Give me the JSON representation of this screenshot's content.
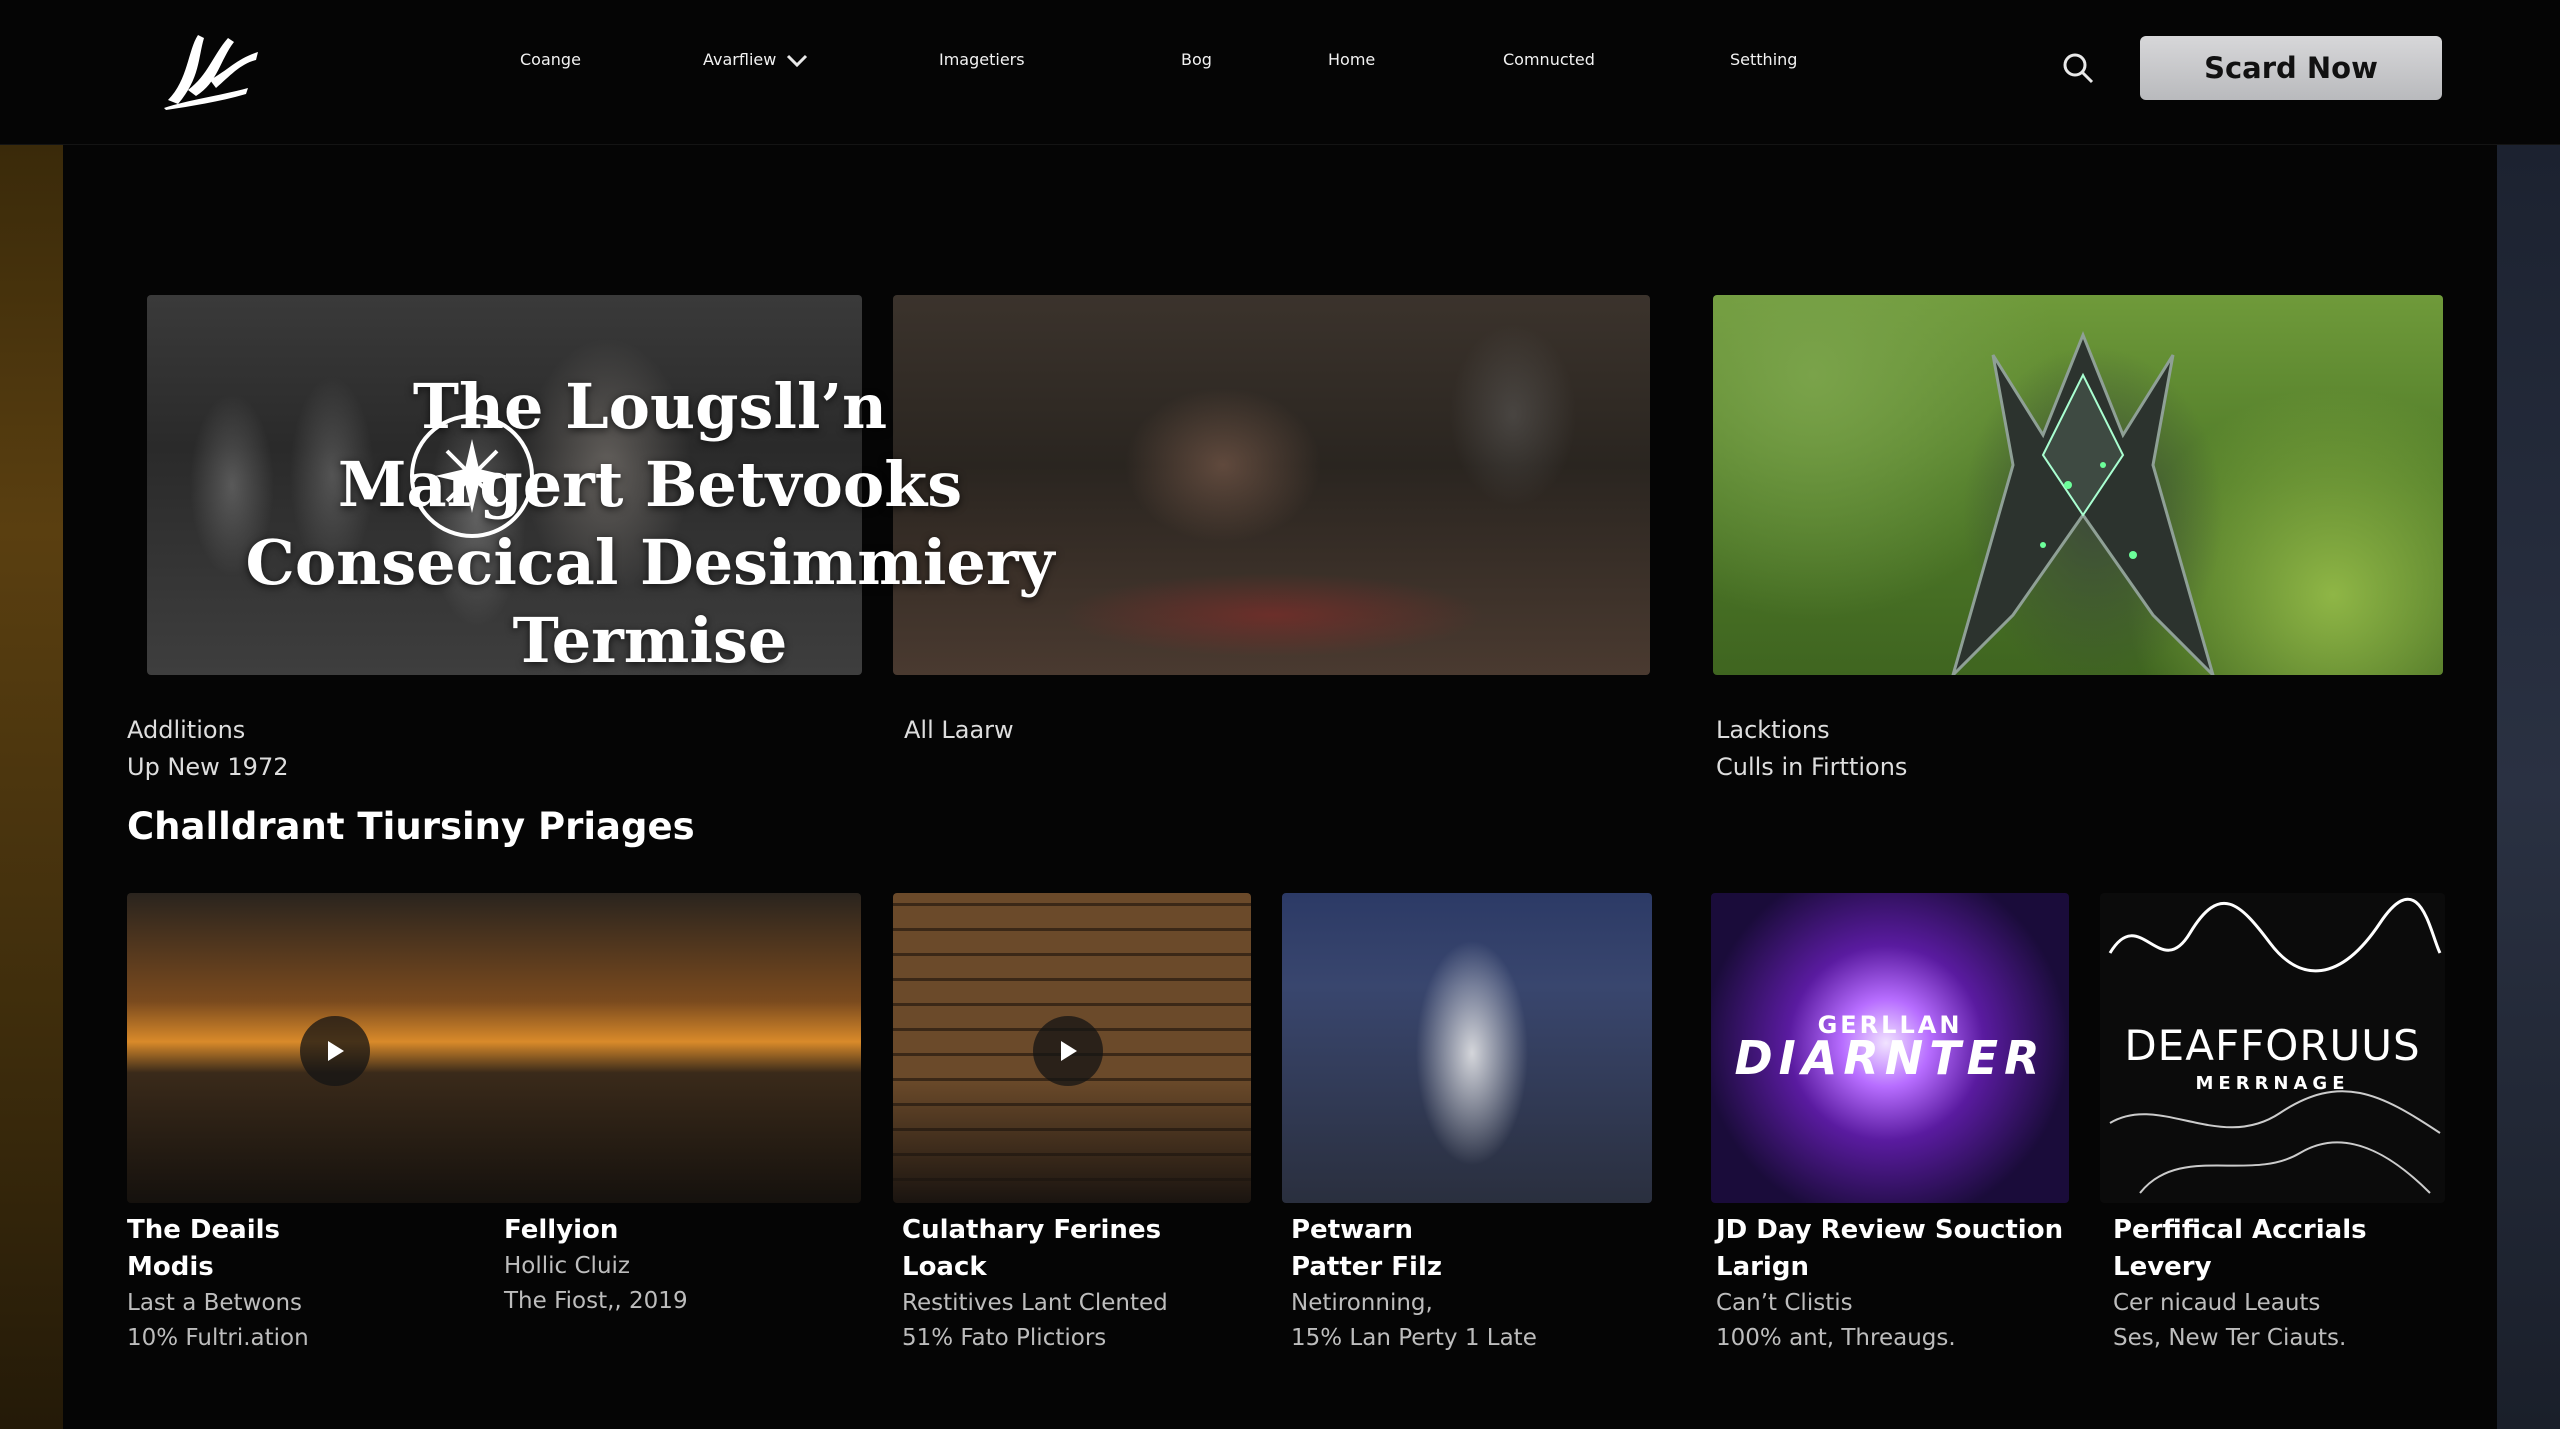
{
  "nav": {
    "items": [
      "Coange",
      "Avarfliew",
      "Imagetiers",
      "Bog",
      "Home",
      "Comnucted",
      "Setthing"
    ],
    "cta_label": "Scard Now"
  },
  "hero": {
    "title_lines": [
      "The Lougsll’n",
      "Margert Betvooks",
      "Consecical Desimmiery Termise"
    ],
    "captions": [
      {
        "line1": "Addlitions",
        "line2": "Up New 1972"
      },
      {
        "line1": "All Laarw",
        "line2": ""
      },
      {
        "line1": "Lacktions",
        "line2": "Culls in Firttions"
      }
    ]
  },
  "section": {
    "title": "Challdrant Tiursiny Priages"
  },
  "tiles": [
    {
      "title": "The Deails",
      "subtitle": "Modis",
      "meta1": "Last a Betwons",
      "meta2": "10% Fultri.ation"
    },
    {
      "title": "Fellyion",
      "subtitle": "",
      "meta1": "Hollic Cluiz",
      "meta2": "The Fiost,, 2019"
    },
    {
      "title": "Culathary Ferines",
      "subtitle": "Loack",
      "meta1": "Restitives Lant Clented",
      "meta2": "51% Fato Plictiors"
    },
    {
      "title": "Petwarn",
      "subtitle": "Patter Filz",
      "meta1": "Netironning,",
      "meta2": "15% Lan Perty 1 Late"
    },
    {
      "title": "JD Day Review Souction",
      "subtitle": "Larign",
      "meta1": "Can’t Clistis",
      "meta2": "100% ant, Threaugs."
    },
    {
      "title": "Perfifical Accrials",
      "subtitle": "Levery",
      "meta1": "Cer nicaud Leauts",
      "meta2": "Ses, New Ter Ciauts."
    }
  ],
  "tile_brands": {
    "t4_small": "GERLLAN",
    "t4_big": "DIARNTER",
    "t5_big": "DEAFFORUUS",
    "t5_small": "MERRNAGE"
  },
  "icons": [
    "logo-icon",
    "chevron-down-icon",
    "search-icon",
    "play-icon",
    "emblem-icon"
  ],
  "colors": {
    "background": "#050505",
    "cta": "#c9c9cb",
    "text": "#f2f2f2"
  }
}
